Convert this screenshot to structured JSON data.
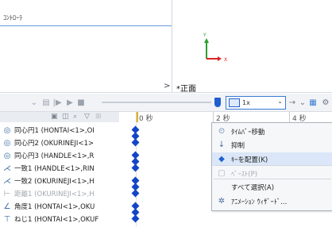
{
  "top_panel": {
    "title": "ｺﾝﾄﾛｰﾗ"
  },
  "triad": {
    "y_label": "Y",
    "x_label": "X"
  },
  "view": {
    "collapse_arrow": ">",
    "name": "*正面"
  },
  "toolbar": {
    "zoom_value": "1x",
    "dropdown_arrow": "⌄"
  },
  "timeline": {
    "time_labels": [
      "0 秒",
      "2 秒",
      "4 秒"
    ]
  },
  "tree_items": [
    {
      "label": "同心円1 (HONTAI<1>,OI",
      "icon": "concentric-mate-icon",
      "dim": false
    },
    {
      "label": "同心円2 (OKURINEJI<1>",
      "icon": "concentric-mate-icon",
      "dim": false
    },
    {
      "label": "同心円3 (HANDLE<1>,R",
      "icon": "concentric-mate-icon",
      "dim": false
    },
    {
      "label": "一致1 (HANDLE<1>,RIN",
      "icon": "coincident-mate-icon",
      "dim": false
    },
    {
      "label": "一致2 (OKURINEJI<1>,H",
      "icon": "coincident-mate-icon",
      "dim": false
    },
    {
      "label": "距離1 (OKURINEJI<1>,H",
      "icon": "distance-mate-icon",
      "dim": true
    },
    {
      "label": "角度1 (HONTAI<1>,OKU",
      "icon": "angle-mate-icon",
      "dim": false
    },
    {
      "label": "ねじ1 (HONTAI<1>,OKUF",
      "icon": "screw-mate-icon",
      "dim": false
    }
  ],
  "context_menu": [
    {
      "label": "ﾀｲﾑﾊﾞｰ移動",
      "icon": "move-timebar-icon",
      "disabled": false,
      "highlight": false
    },
    {
      "label": "抑制",
      "icon": "suppress-icon",
      "disabled": false,
      "highlight": false
    },
    {
      "label": "ｷｰを配置(K)",
      "icon": "place-key-icon",
      "disabled": false,
      "highlight": true
    },
    {
      "label": "ﾍﾟｰｽﾄ(P)",
      "icon": "paste-icon",
      "disabled": true,
      "highlight": false
    },
    {
      "label": "すべて選択(A)",
      "icon": "",
      "disabled": false,
      "highlight": false
    },
    {
      "label": "ｱﾆﾒｰｼｮﾝ ｳｨｻﾞｰﾄﾞ...",
      "icon": "animation-wizard-icon",
      "disabled": false,
      "highlight": false
    }
  ],
  "colors": {
    "accent": "#1f5fd1",
    "keyframe": "#1346c7",
    "playhead": "#e2b61d",
    "highlight": "#dbe7f8"
  }
}
